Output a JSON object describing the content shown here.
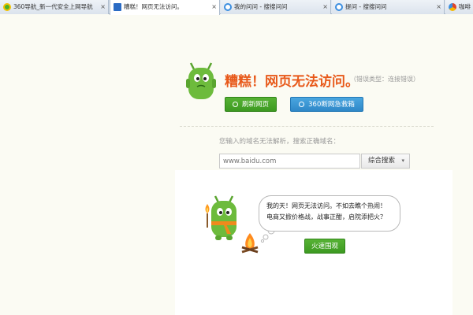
{
  "tabs": [
    {
      "title": "360导航_新一代安全上网导航",
      "icon": "360-nav-icon",
      "color": "#4caf2a",
      "active": false
    },
    {
      "title": "糟糕！网页无法访问。",
      "icon": "error-page-icon",
      "color": "#2a6bc4",
      "active": true
    },
    {
      "title": "我的问问 - 搜搜问问",
      "icon": "soso-icon",
      "color": "#3b8ee0",
      "active": false
    },
    {
      "title": "提问 - 搜搜问问",
      "icon": "soso-icon",
      "color": "#3b8ee0",
      "active": false
    },
    {
      "title": "咖啡",
      "icon": "browser-icon",
      "color": "#e0462a",
      "active": false
    }
  ],
  "tab_close_glyph": "×",
  "error": {
    "title": "糟糕！网页无法访问。",
    "type_text": "（错误类型：连接错误）",
    "refresh_label": "刷新网页",
    "rescue_label": "360断网急救箱"
  },
  "search": {
    "hint": "您输入的域名无法解析，搜索正确域名：",
    "placeholder": "www.baidu.com",
    "button_label": "综合搜索",
    "dropdown_glyph": "▾"
  },
  "promo": {
    "bubble_lines": [
      "我的天！网页无法访问。不如去瞧个热闹！",
      "电商又掀价格战，战事正酣，启院添把火？"
    ],
    "button_label": "火速围观"
  },
  "colors": {
    "accent_orange": "#e8591a",
    "button_green": "#3d9a21",
    "button_blue": "#2f88c8",
    "mascot_green": "#6dbb3c"
  }
}
